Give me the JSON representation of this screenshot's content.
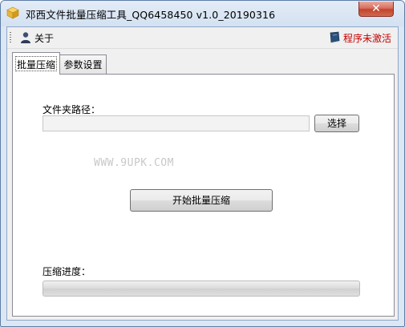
{
  "window": {
    "title": "邓西文件批量压缩工具_QQ6458450 v1.0_20190316",
    "close_glyph": "✕",
    "app_icon": "box-icon"
  },
  "toolbar": {
    "about_label": "关于",
    "about_icon": "user-icon",
    "unregistered_label": "程序未激活",
    "unregistered_icon": "book-icon",
    "unregistered_color": "#c40000"
  },
  "tabs": [
    {
      "label": "批量压缩",
      "active": true
    },
    {
      "label": "参数设置",
      "active": false
    }
  ],
  "main": {
    "folder_path_label": "文件夹路径：",
    "folder_path_value": "",
    "choose_button": "选择",
    "watermark": "WWW.9UPK.COM",
    "start_button": "开始批量压缩",
    "progress_label": "压缩进度：",
    "progress_fraction": 0
  }
}
